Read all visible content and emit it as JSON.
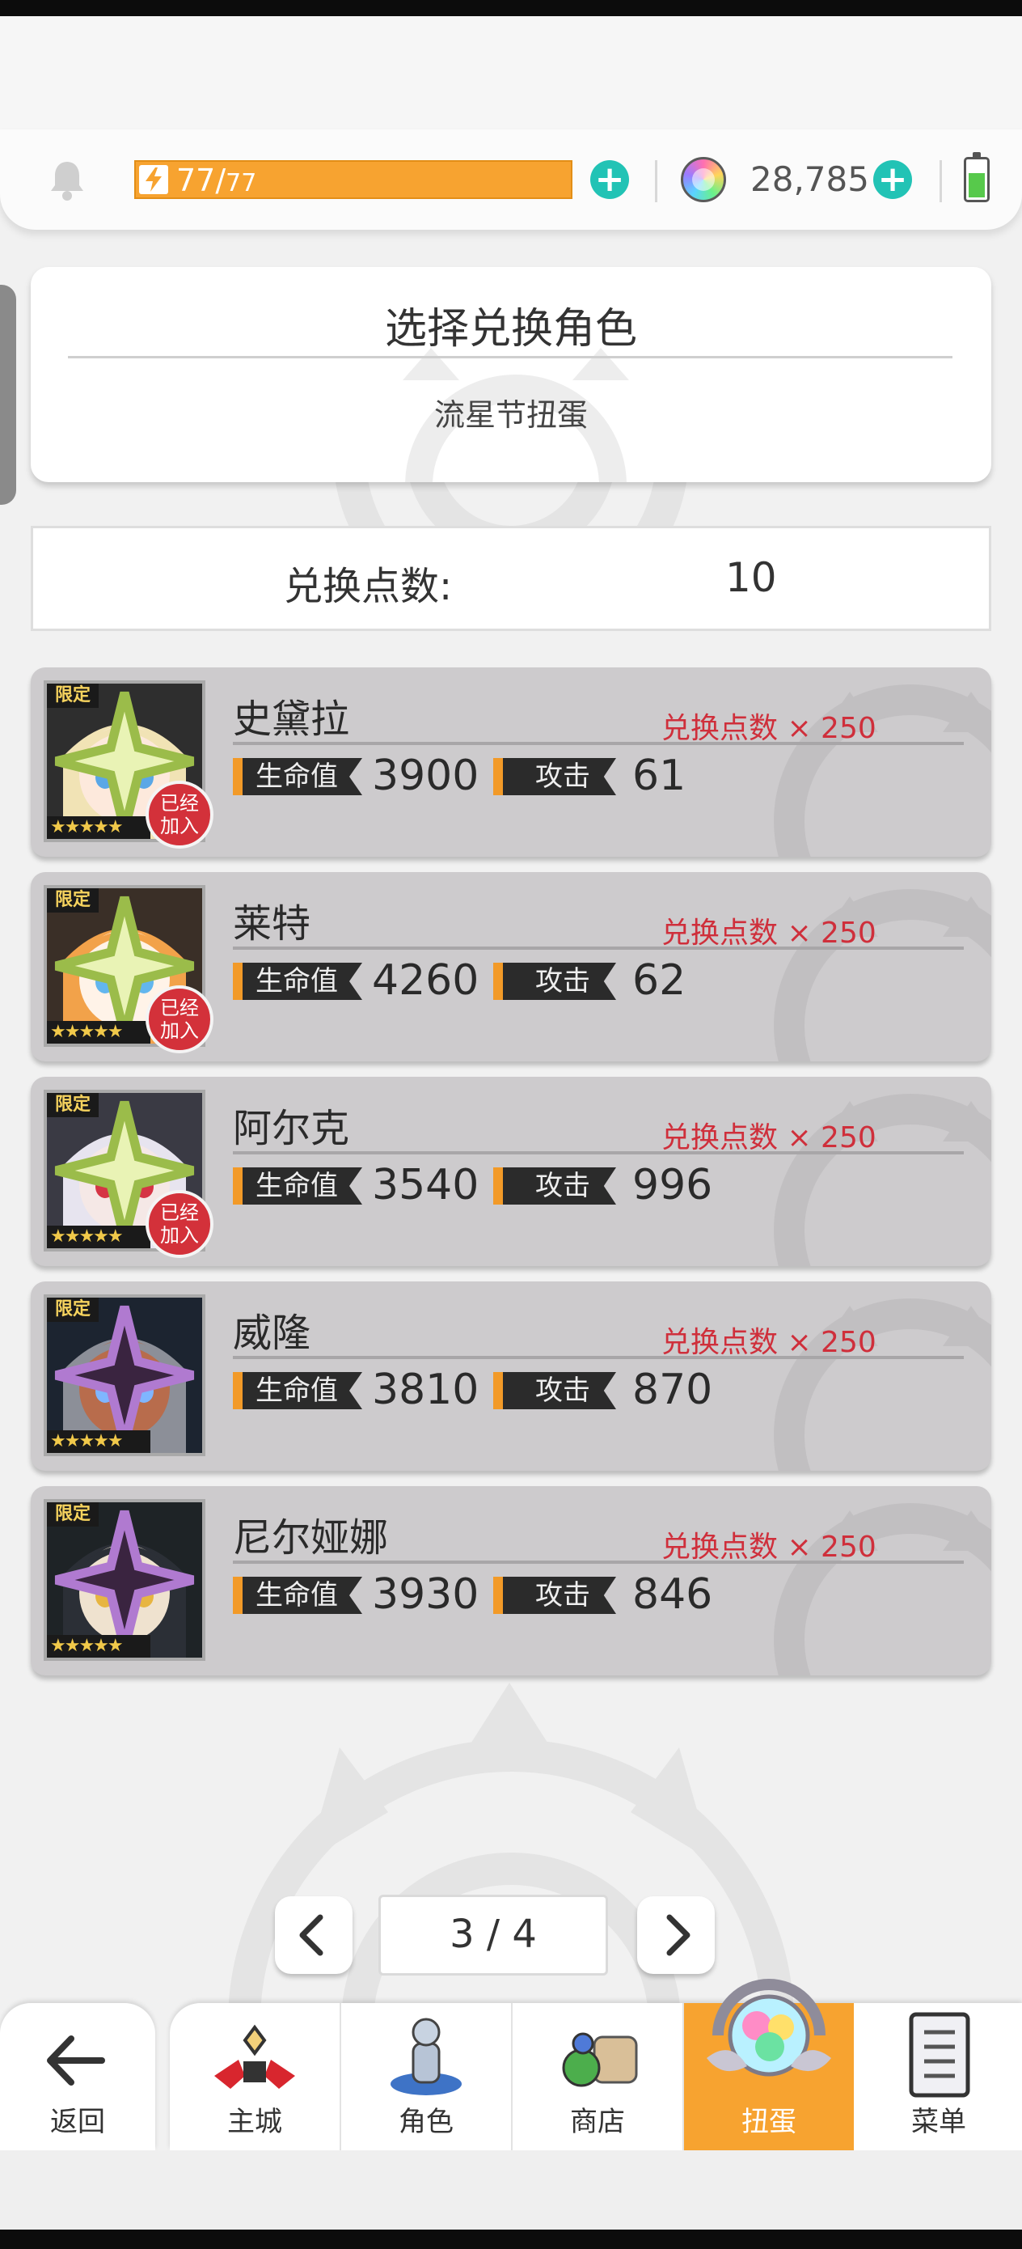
{
  "topbar": {
    "stamina_current": "77",
    "stamina_max": "77",
    "gems": "28,785"
  },
  "header": {
    "title": "选择兑换角色",
    "subtitle": "流星节扭蛋"
  },
  "points": {
    "label": "兑换点数:",
    "value": "10"
  },
  "labels": {
    "hp": "生命值",
    "atk": "攻击",
    "limited": "限定",
    "joined_line1": "已经",
    "joined_line2": "加入",
    "stars": "★★★★★"
  },
  "characters": [
    {
      "name": "史黛拉",
      "cost": "兑换点数 × 250",
      "hp": "3900",
      "atk": "61",
      "joined": true
    },
    {
      "name": "莱特",
      "cost": "兑换点数 × 250",
      "hp": "4260",
      "atk": "62",
      "joined": true
    },
    {
      "name": "阿尔克",
      "cost": "兑换点数 × 250",
      "hp": "3540",
      "atk": "996",
      "joined": true
    },
    {
      "name": "威隆",
      "cost": "兑换点数 × 250",
      "hp": "3810",
      "atk": "870",
      "joined": false
    },
    {
      "name": "尼尔娅娜",
      "cost": "兑换点数 × 250",
      "hp": "3930",
      "atk": "846",
      "joined": false
    }
  ],
  "pagination": {
    "label": "3 / 4"
  },
  "nav": {
    "back": "返回",
    "items": [
      "主城",
      "角色",
      "商店",
      "扭蛋",
      "菜单"
    ],
    "active": "扭蛋"
  },
  "colors": {
    "accent_orange": "#f7a330",
    "plus_teal": "#22c3b5",
    "cost_red": "#cf2f3b",
    "row_gray": "#cdcbcd"
  },
  "icons": [
    "bell-icon",
    "bolt-icon",
    "plus-icon",
    "rainbow-gem-icon",
    "battery-icon",
    "back-arrow-icon",
    "chevron-left-icon",
    "chevron-right-icon",
    "castle-icon",
    "character-icon",
    "shop-icon",
    "gacha-icon",
    "menu-icon"
  ]
}
